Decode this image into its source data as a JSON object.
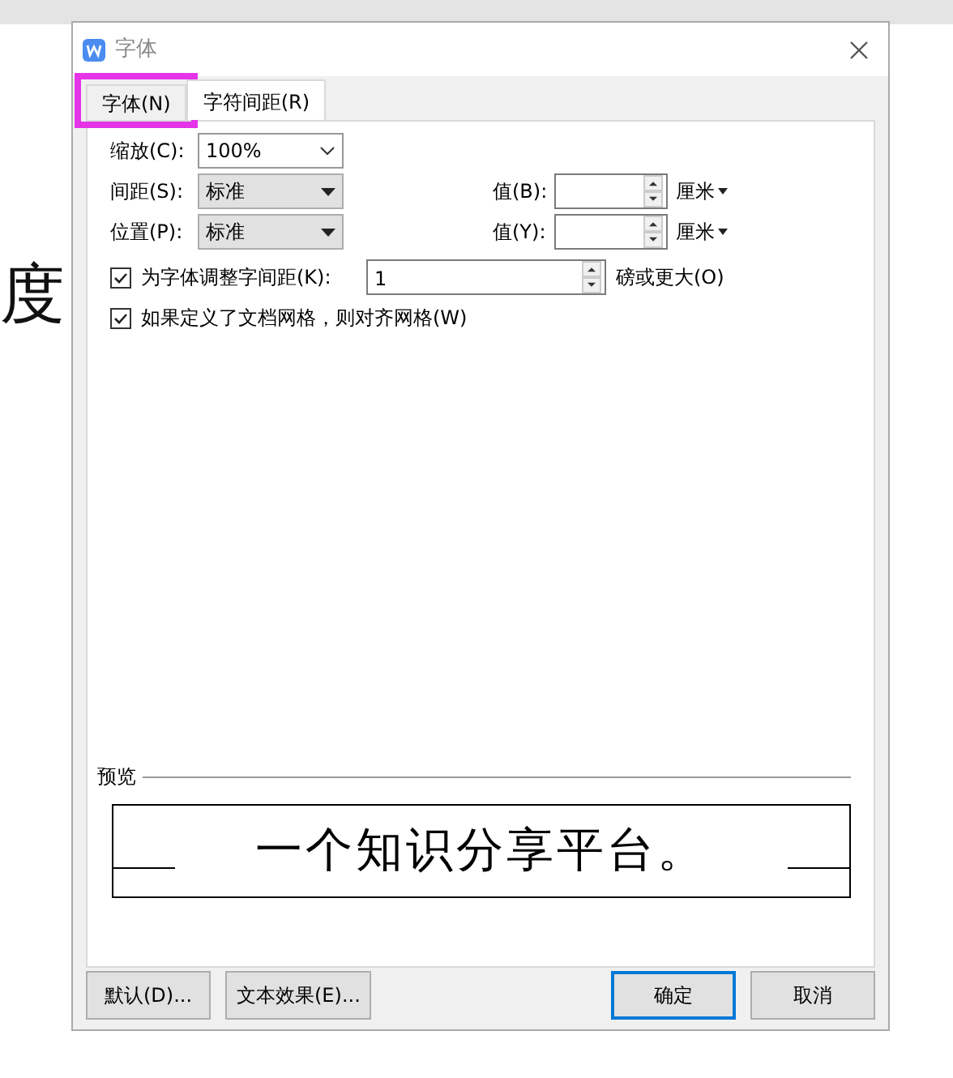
{
  "background_text": "度",
  "window": {
    "title": "字体"
  },
  "tabs": [
    {
      "label": "字体(N)",
      "selected": false,
      "highlighted": true
    },
    {
      "label": "字符间距(R)",
      "selected": true,
      "highlighted": false
    }
  ],
  "scale": {
    "label": "缩放(C):",
    "value": "100%"
  },
  "spacing": {
    "label": "间距(S):",
    "value": "标准",
    "value_label": "值(B):",
    "unit": "厘米"
  },
  "position": {
    "label": "位置(P):",
    "value": "标准",
    "value_label": "值(Y):",
    "unit": "厘米"
  },
  "kerning": {
    "label": "为字体调整字间距(K):",
    "checked": true,
    "value": "1",
    "suffix": "磅或更大(O)"
  },
  "grid": {
    "label": "如果定义了文档网格，则对齐网格(W)",
    "checked": true
  },
  "preview": {
    "label": "预览",
    "text": "一个知识分享平台。"
  },
  "buttons": [
    {
      "label": "默认(D)...",
      "default": false
    },
    {
      "label": "文本效果(E)...",
      "default": false
    },
    {
      "label": "确定",
      "default": true
    },
    {
      "label": "取消",
      "default": false
    }
  ]
}
